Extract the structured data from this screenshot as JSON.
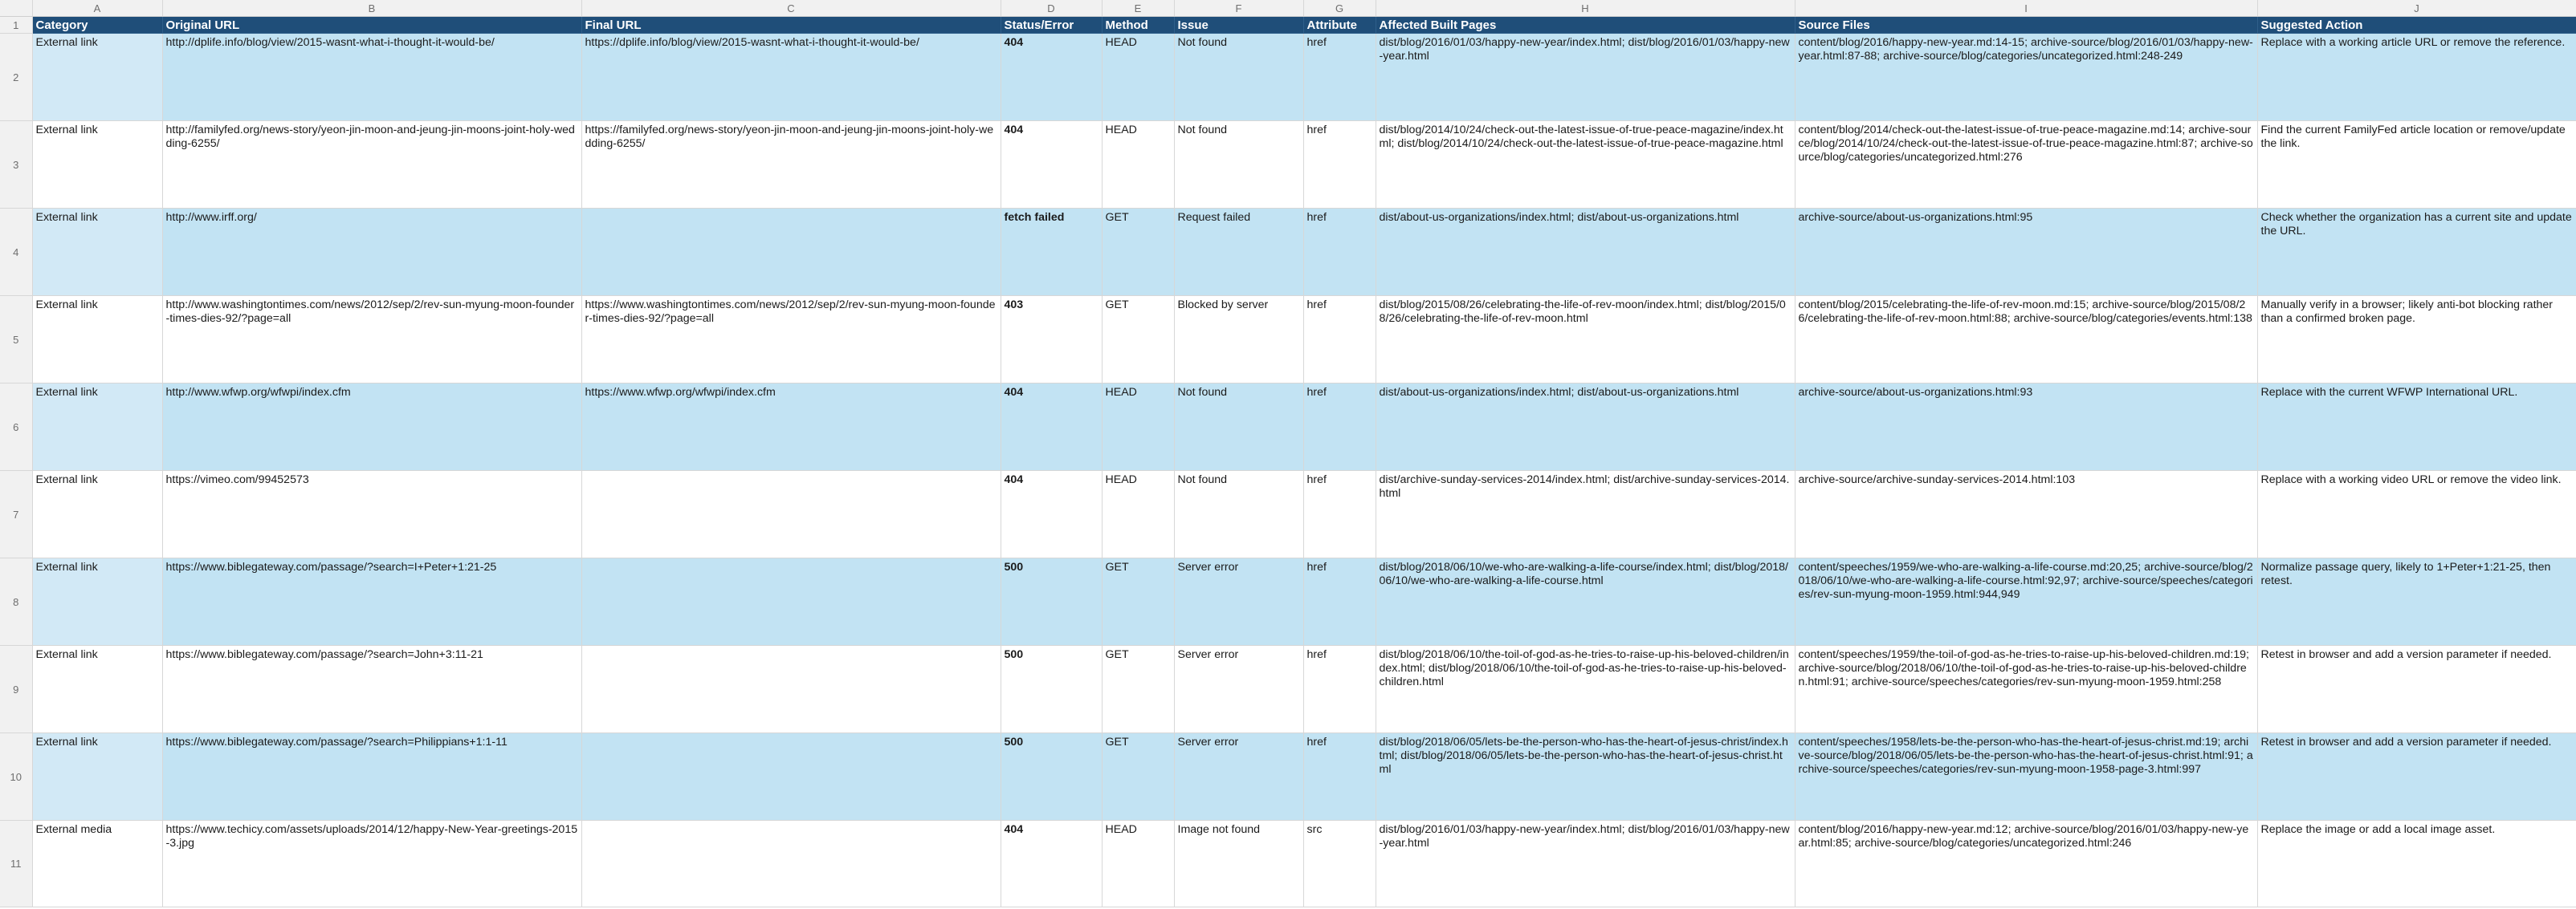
{
  "columns": [
    "A",
    "B",
    "C",
    "D",
    "E",
    "F",
    "G",
    "H",
    "I",
    "J"
  ],
  "headers": [
    "Category",
    "Original URL",
    "Final URL",
    "Status/Error",
    "Method",
    "Issue",
    "Attribute",
    "Affected Built Pages",
    "Source Files",
    "Suggested Action"
  ],
  "rows": [
    {
      "num": "2",
      "category": "External link",
      "original": "http://dplife.info/blog/view/2015-wasnt-what-i-thought-it-would-be/",
      "final": "https://dplife.info/blog/view/2015-wasnt-what-i-thought-it-would-be/",
      "status": "404",
      "method": "HEAD",
      "issue": "Not found",
      "attribute": "href",
      "pages": "dist/blog/2016/01/03/happy-new-year/index.html; dist/blog/2016/01/03/happy-new-year.html",
      "sources": "content/blog/2016/happy-new-year.md:14-15; archive-source/blog/2016/01/03/happy-new-year.html:87-88; archive-source/blog/categories/uncategorized.html:248-249",
      "action": "Replace with a working article URL or remove the reference."
    },
    {
      "num": "3",
      "category": "External link",
      "original": "http://familyfed.org/news-story/yeon-jin-moon-and-jeung-jin-moons-joint-holy-wedding-6255/",
      "final": "https://familyfed.org/news-story/yeon-jin-moon-and-jeung-jin-moons-joint-holy-wedding-6255/",
      "status": "404",
      "method": "HEAD",
      "issue": "Not found",
      "attribute": "href",
      "pages": "dist/blog/2014/10/24/check-out-the-latest-issue-of-true-peace-magazine/index.html; dist/blog/2014/10/24/check-out-the-latest-issue-of-true-peace-magazine.html",
      "sources": "content/blog/2014/check-out-the-latest-issue-of-true-peace-magazine.md:14; archive-source/blog/2014/10/24/check-out-the-latest-issue-of-true-peace-magazine.html:87; archive-source/blog/categories/uncategorized.html:276",
      "action": "Find the current FamilyFed article location or remove/update the link."
    },
    {
      "num": "4",
      "category": "External link",
      "original": "http://www.irff.org/",
      "final": "",
      "status": "fetch failed",
      "method": "GET",
      "issue": "Request failed",
      "attribute": "href",
      "pages": "dist/about-us-organizations/index.html; dist/about-us-organizations.html",
      "sources": "archive-source/about-us-organizations.html:95",
      "action": "Check whether the organization has a current site and update the URL."
    },
    {
      "num": "5",
      "category": "External link",
      "original": "http://www.washingtontimes.com/news/2012/sep/2/rev-sun-myung-moon-founder-times-dies-92/?page=all",
      "final": "https://www.washingtontimes.com/news/2012/sep/2/rev-sun-myung-moon-founder-times-dies-92/?page=all",
      "status": "403",
      "method": "GET",
      "issue": "Blocked by server",
      "attribute": "href",
      "pages": "dist/blog/2015/08/26/celebrating-the-life-of-rev-moon/index.html; dist/blog/2015/08/26/celebrating-the-life-of-rev-moon.html",
      "sources": "content/blog/2015/celebrating-the-life-of-rev-moon.md:15; archive-source/blog/2015/08/26/celebrating-the-life-of-rev-moon.html:88; archive-source/blog/categories/events.html:138",
      "action": "Manually verify in a browser; likely anti-bot blocking rather than a confirmed broken page."
    },
    {
      "num": "6",
      "category": "External link",
      "original": "http://www.wfwp.org/wfwpi/index.cfm",
      "final": "https://www.wfwp.org/wfwpi/index.cfm",
      "status": "404",
      "method": "HEAD",
      "issue": "Not found",
      "attribute": "href",
      "pages": "dist/about-us-organizations/index.html; dist/about-us-organizations.html",
      "sources": "archive-source/about-us-organizations.html:93",
      "action": "Replace with the current WFWP International URL."
    },
    {
      "num": "7",
      "category": "External link",
      "original": "https://vimeo.com/99452573",
      "final": "",
      "status": "404",
      "method": "HEAD",
      "issue": "Not found",
      "attribute": "href",
      "pages": "dist/archive-sunday-services-2014/index.html; dist/archive-sunday-services-2014.html",
      "sources": "archive-source/archive-sunday-services-2014.html:103",
      "action": "Replace with a working video URL or remove the video link."
    },
    {
      "num": "8",
      "category": "External link",
      "original": "https://www.biblegateway.com/passage/?search=I+Peter+1:21-25",
      "final": "",
      "status": "500",
      "method": "GET",
      "issue": "Server error",
      "attribute": "href",
      "pages": "dist/blog/2018/06/10/we-who-are-walking-a-life-course/index.html; dist/blog/2018/06/10/we-who-are-walking-a-life-course.html",
      "sources": "content/speeches/1959/we-who-are-walking-a-life-course.md:20,25; archive-source/blog/2018/06/10/we-who-are-walking-a-life-course.html:92,97; archive-source/speeches/categories/rev-sun-myung-moon-1959.html:944,949",
      "action": "Normalize passage query, likely to 1+Peter+1:21-25, then retest."
    },
    {
      "num": "9",
      "category": "External link",
      "original": "https://www.biblegateway.com/passage/?search=John+3:11-21",
      "final": "",
      "status": "500",
      "method": "GET",
      "issue": "Server error",
      "attribute": "href",
      "pages": "dist/blog/2018/06/10/the-toil-of-god-as-he-tries-to-raise-up-his-beloved-children/index.html; dist/blog/2018/06/10/the-toil-of-god-as-he-tries-to-raise-up-his-beloved-children.html",
      "sources": "content/speeches/1959/the-toil-of-god-as-he-tries-to-raise-up-his-beloved-children.md:19; archive-source/blog/2018/06/10/the-toil-of-god-as-he-tries-to-raise-up-his-beloved-children.html:91; archive-source/speeches/categories/rev-sun-myung-moon-1959.html:258",
      "action": "Retest in browser and add a version parameter if needed."
    },
    {
      "num": "10",
      "category": "External link",
      "original": "https://www.biblegateway.com/passage/?search=Philippians+1:1-11",
      "final": "",
      "status": "500",
      "method": "GET",
      "issue": "Server error",
      "attribute": "href",
      "pages": "dist/blog/2018/06/05/lets-be-the-person-who-has-the-heart-of-jesus-christ/index.html; dist/blog/2018/06/05/lets-be-the-person-who-has-the-heart-of-jesus-christ.html",
      "sources": "content/speeches/1958/lets-be-the-person-who-has-the-heart-of-jesus-christ.md:19; archive-source/blog/2018/06/05/lets-be-the-person-who-has-the-heart-of-jesus-christ.html:91; archive-source/speeches/categories/rev-sun-myung-moon-1958-page-3.html:997",
      "action": "Retest in browser and add a version parameter if needed."
    },
    {
      "num": "11",
      "category": "External media",
      "original": "https://www.techicy.com/assets/uploads/2014/12/happy-New-Year-greetings-2015-3.jpg",
      "final": "",
      "status": "404",
      "method": "HEAD",
      "issue": "Image not found",
      "attribute": "src",
      "pages": "dist/blog/2016/01/03/happy-new-year/index.html; dist/blog/2016/01/03/happy-new-year.html",
      "sources": "content/blog/2016/happy-new-year.md:12; archive-source/blog/2016/01/03/happy-new-year.html:85; archive-source/blog/categories/uncategorized.html:246",
      "action": "Replace the image or add a local image asset."
    }
  ]
}
